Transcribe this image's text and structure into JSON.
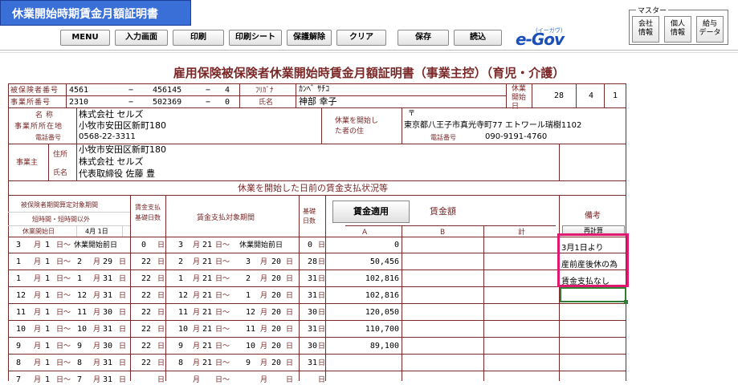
{
  "app": {
    "title": "休業開始時期賃金月額証明書"
  },
  "toolbar": {
    "menu": "MENU",
    "input_screen": "入力画面",
    "print": "印刷",
    "print_sheet": "印刷シート",
    "unlock": "保護解除",
    "clear": "クリア",
    "save": "保存",
    "load": "読込",
    "egov": "e-Gov",
    "egov_sub": "(イーガヴ)"
  },
  "master": {
    "label": "マスター",
    "company": "会社\n情報",
    "personal": "個人\n情報",
    "salary": "給与\nデータ"
  },
  "document": {
    "title": "雇用保険被保険者休業開始時賃金月額証明書（事業主控）（育児・介護）",
    "insured_no_label": "被保険者番号",
    "insured_no": [
      "4561",
      "−",
      "456145",
      "−",
      "4"
    ],
    "office_no_label": "事業所番号",
    "office_no": [
      "2310",
      "−",
      "502369",
      "−",
      "0"
    ],
    "furigana_label": "ﾌﾘｶﾞﾅ",
    "furigana": "ｶﾝﾍﾞ ｻﾁｺ",
    "name_label": "氏名",
    "name": "神部 幸子",
    "leave_start_label": "休業開始日",
    "leave_start": [
      "28",
      "4",
      "1"
    ],
    "office_name_label": "名称",
    "office_name": "株式会社 セルズ",
    "office_addr_label": "事業所所在地",
    "office_addr": "小牧市安田区新町180",
    "office_tel_label": "電話番号",
    "office_tel": "0568-22-3311",
    "person_addr_label": "休業を開始した者の住",
    "postal_mark": "〒",
    "person_addr": "東京都八王子市真光寺町77 エトワール瑞樹1102",
    "person_tel_label": "電話番号",
    "person_tel": "090-9191-4760",
    "employer_label": "事業主",
    "employer_addr_label": "住所",
    "employer_name_label": "氏名",
    "employer_addr": "小牧市安田区新町180",
    "employer_company": "株式会社 セルズ",
    "employer_rep": "代表取締役 佐藤 豊",
    "section_title": "休業を開始した日前の賃金支払状況等",
    "col_insured_period": "被保険者期間算定対象期間",
    "col_parttime": "短時間・短時間以外",
    "col_leave_start": "休業開始日",
    "leave_start_md": "4月 1日",
    "col_pay_days": "賃金支払基礎日数",
    "col_pay_period": "賃金支払対象期間",
    "col_basis_days": "基礎日数",
    "kingaku_button": "賃金適用",
    "col_amount": "賃金額",
    "col_a": "A",
    "col_b": "B",
    "col_total": "計",
    "col_remarks": "備考",
    "recalc_button": "再計算",
    "remarks": [
      "3月1日より",
      "産前産後休の為",
      "賃金支払なし"
    ],
    "rows": [
      {
        "p1m": "3",
        "p1d": "1",
        "p1e": "休業開始前日",
        "days": "0",
        "p2m": "3",
        "p2d": "21",
        "p2e": "休業開始前日",
        "bdays": "0",
        "a": "0"
      },
      {
        "p1m": "1",
        "p1d": "1",
        "p2em": "2",
        "p2ed": "29",
        "days": "22",
        "p2m": "2",
        "p2d": "21",
        "p3m": "3",
        "p3d": "20",
        "bdays": "28",
        "a": "50,456"
      },
      {
        "p1m": "1",
        "p1d": "1",
        "p2em": "1",
        "p2ed": "31",
        "days": "22",
        "p2m": "1",
        "p2d": "21",
        "p3m": "2",
        "p3d": "20",
        "bdays": "31",
        "a": "102,816"
      },
      {
        "p1m": "12",
        "p1d": "1",
        "p2em": "12",
        "p2ed": "31",
        "days": "22",
        "p2m": "12",
        "p2d": "21",
        "p3m": "1",
        "p3d": "20",
        "bdays": "31",
        "a": "102,816"
      },
      {
        "p1m": "11",
        "p1d": "1",
        "p2em": "11",
        "p2ed": "30",
        "days": "22",
        "p2m": "11",
        "p2d": "21",
        "p3m": "12",
        "p3d": "20",
        "bdays": "30",
        "a": "120,050"
      },
      {
        "p1m": "10",
        "p1d": "1",
        "p2em": "10",
        "p2ed": "31",
        "days": "22",
        "p2m": "10",
        "p2d": "21",
        "p3m": "11",
        "p3d": "20",
        "bdays": "31",
        "a": "110,700"
      },
      {
        "p1m": "9",
        "p1d": "1",
        "p2em": "9",
        "p2ed": "30",
        "days": "22",
        "p2m": "9",
        "p2d": "21",
        "p3m": "10",
        "p3d": "20",
        "bdays": "30",
        "a": "89,100"
      },
      {
        "p1m": "8",
        "p1d": "1",
        "p2em": "8",
        "p2ed": "31",
        "days": "22",
        "p2m": "8",
        "p2d": "21",
        "p3m": "9",
        "p3d": "20",
        "bdays": "31",
        "a": ""
      },
      {
        "p1m": "7",
        "p1d": "1",
        "p2em": "7",
        "p2ed": "31",
        "days": "",
        "p2m": "",
        "p2d": "",
        "p3m": "",
        "p3d": "",
        "bdays": "",
        "a": ""
      }
    ],
    "unit_month": "月",
    "unit_day": "日",
    "tilde": "～"
  },
  "colors": {
    "title_bg": "#3a6fd8",
    "border": "#7a2828",
    "highlight": "#e0186f",
    "selection": "#2e7d32"
  }
}
